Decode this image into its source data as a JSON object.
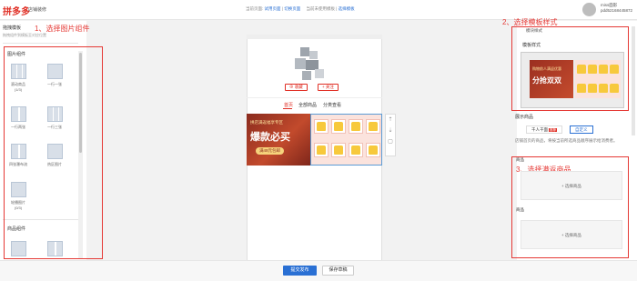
{
  "header": {
    "logo": "拼多多",
    "logo_sub": "店铺装修",
    "current_page_label": "当前页面:",
    "current_page_value": "试用页面",
    "switch_page": "切换页面",
    "current_template_label": "当前未使用模板",
    "select_template": "选择模板",
    "user_name": "miss面影",
    "user_id": "pdd52168445872"
  },
  "left_panel": {
    "title": "拖拽模板",
    "hint": "拖拽组件到模板至对应位置",
    "section_image": "图片组件",
    "image_components": [
      {
        "name": "滚动商品",
        "sub": "(1/3)"
      },
      {
        "name": "一行一张",
        "sub": ""
      },
      {
        "name": "一行两张",
        "sub": ""
      },
      {
        "name": "一行三张",
        "sub": ""
      },
      {
        "name": "四张瀑布流",
        "sub": ""
      },
      {
        "name": "热区图片",
        "sub": ""
      },
      {
        "name": "轮播图片",
        "sub": "(0/3)"
      }
    ],
    "section_goods": "商品组件"
  },
  "phone": {
    "btn_collect": "收藏",
    "btn_follow": "关注",
    "tabs": [
      "首页",
      "全部商品",
      "分类查看"
    ],
    "banner_small": "拼店满返福享专区",
    "banner_big": "爆款必买",
    "banner_tag": "满49元包邮"
  },
  "right_panel": {
    "template_header": "模块样式",
    "template_label": "模板样式",
    "tpl_small": "购物前人满返优惠",
    "tpl_big": "分抢双双",
    "display_label": "展示商品",
    "option_auto": "千人千面",
    "option_auto_badge": "推荐",
    "option_custom": "自定义",
    "desc": "店铺首页的商品，将按当前所选商品顺序展示给消费者。",
    "goods_label_1": "商品",
    "add_goods_1": "+ 选择商品",
    "goods_label_2": "商品",
    "add_goods_2": "+ 选择商品"
  },
  "footer": {
    "submit": "提交发布",
    "save_draft": "保存草稿"
  },
  "annotations": {
    "step1": "1、选择图片组件",
    "step2": "2、选择模板样式",
    "step3": "3、选择满返商品"
  },
  "colors": {
    "accent_red": "#e02e24",
    "brand_blue": "#2a70d4",
    "annotation_red": "#e53935"
  }
}
